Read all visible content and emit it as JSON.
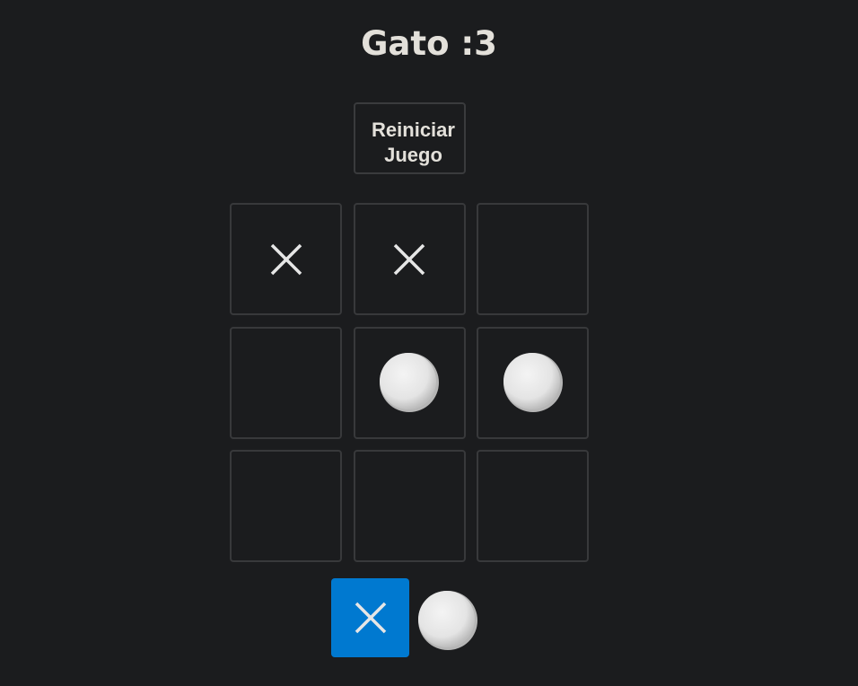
{
  "title": "Gato :3",
  "reset_button": {
    "line1": "Reiniciar",
    "line2": "Juego"
  },
  "board": [
    [
      "X",
      "X",
      ""
    ],
    [
      "",
      "O",
      "O"
    ],
    [
      "",
      "",
      ""
    ]
  ],
  "turn_indicator": {
    "active": "X",
    "players": [
      "X",
      "O"
    ]
  },
  "colors": {
    "background": "#1b1c1e",
    "cell_border": "#38393b",
    "text": "#e3e0da",
    "active_turn": "#0079d0"
  },
  "icons": {
    "X": "cross-icon",
    "O": "white-circle-icon"
  }
}
